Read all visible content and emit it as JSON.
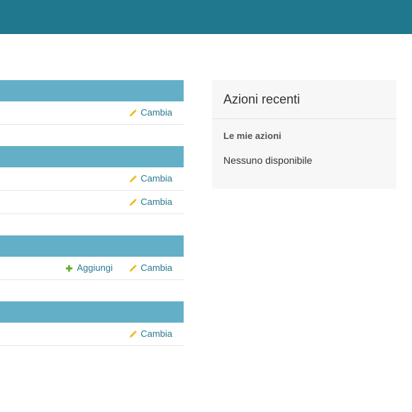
{
  "colors": {
    "header": "#20788f",
    "module_caption": "#64afc8",
    "link": "#2a7a92",
    "change_icon": "#efb80b",
    "add_icon": "#5fb321"
  },
  "modules": [
    {
      "rows": [
        {
          "change_label": "Cambia"
        }
      ]
    },
    {
      "rows": [
        {
          "change_label": "Cambia"
        },
        {
          "change_label": "Cambia"
        }
      ]
    },
    {
      "rows": [
        {
          "add_label": "Aggiungi",
          "change_label": "Cambia"
        }
      ]
    },
    {
      "rows": [
        {
          "change_label": "Cambia"
        }
      ]
    }
  ],
  "recent_actions": {
    "title": "Azioni recenti",
    "subtitle": "Le mie azioni",
    "empty_text": "Nessuno disponibile"
  },
  "icons": {
    "change": "pencil-icon",
    "add": "plus-icon"
  }
}
